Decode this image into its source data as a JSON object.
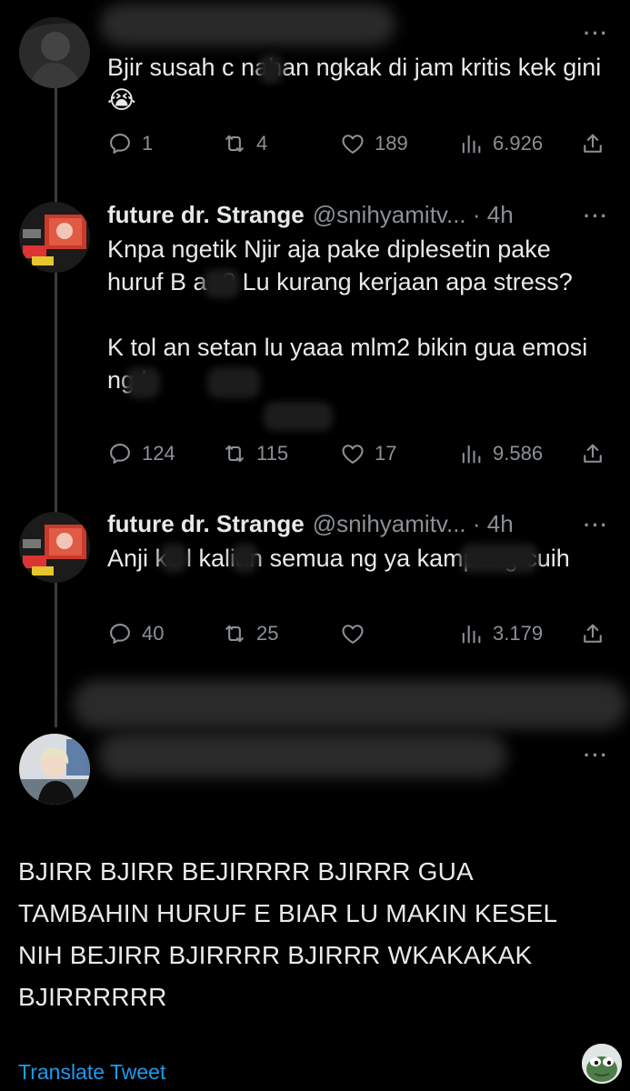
{
  "thread": [
    {
      "display_name": "",
      "handle_time": "",
      "text": [
        "Bjir susah c    nahan ngkak di jam kritis kek gini 😭"
      ],
      "actions": {
        "replies": "1",
        "retweets": "4",
        "likes": "189",
        "views": "6.926"
      }
    },
    {
      "display_name": "future dr. Strange",
      "handle_time": "@snihyamitv... · 4h",
      "text": [
        "Knpa ngetik Njir aja pake diplesetin pake huruf B a    r? Lu kurang kerjaan apa stress?",
        "K     tol an     setan lu yaaa mlm2 bikin gua emosi ng         l"
      ],
      "actions": {
        "replies": "124",
        "retweets": "115",
        "likes": "17",
        "views": "9.586"
      }
    },
    {
      "display_name": "future dr. Strange",
      "handle_time": "@snihyamitv... · 4h",
      "text": [
        "Anji    kc    l kalian semua ng       ya kampang cuih"
      ],
      "actions": {
        "replies": "40",
        "retweets": "25",
        "likes": "",
        "views": "3.179"
      }
    }
  ],
  "main_tweet": {
    "lines": [
      "BJIRR BJIRR BEJIRRRR BJIRRR GUA",
      "TAMBAHIN HURUF E BIAR LU MAKIN KESEL",
      "NIH BEJIRR BJIRRRR BJIRRR WKAKAKAK",
      "BJIRRRRRR"
    ],
    "translate_label": "Translate Tweet"
  },
  "icons": {
    "reply": "reply-icon",
    "retweet": "retweet-icon",
    "like": "heart-icon",
    "views": "views-icon",
    "share": "share-icon",
    "more": "more-icon"
  },
  "colors": {
    "background": "#000000",
    "text": "#e7e9ea",
    "secondary": "#8b9096",
    "link": "#1d9bf0"
  }
}
